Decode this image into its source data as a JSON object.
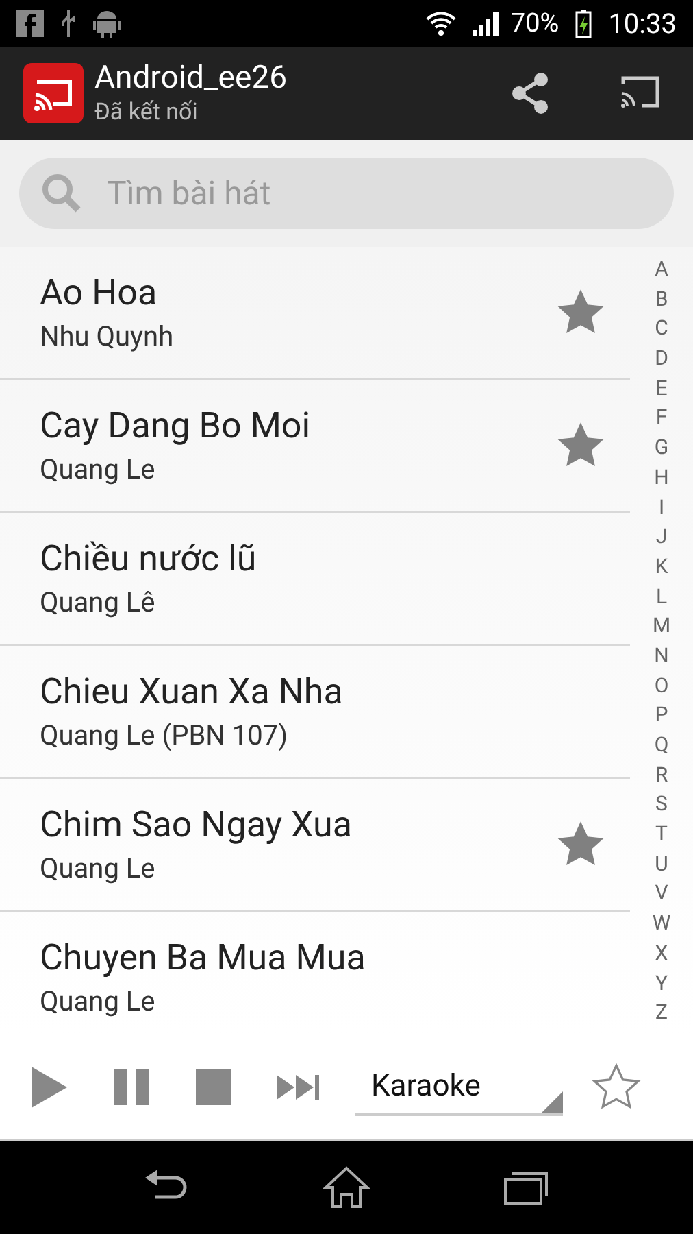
{
  "status_bar": {
    "battery": "70%",
    "time": "10:33"
  },
  "action_bar": {
    "title": "Android_ee26",
    "subtitle": "Đã kết nối"
  },
  "search": {
    "placeholder": "Tìm bài hát"
  },
  "songs": [
    {
      "title": "Ao Hoa",
      "artist": "Nhu Quynh",
      "favorite": true
    },
    {
      "title": "Cay Dang Bo Moi",
      "artist": "Quang Le",
      "favorite": true
    },
    {
      "title": "Chiều nước lũ",
      "artist": "Quang Lê",
      "favorite": false
    },
    {
      "title": "Chieu Xuan Xa Nha",
      "artist": "Quang Le (PBN 107)",
      "favorite": false
    },
    {
      "title": "Chim Sao Ngay Xua",
      "artist": "Quang Le",
      "favorite": true
    },
    {
      "title": "Chuyen Ba Mua Mua",
      "artist": "Quang Le",
      "favorite": false
    }
  ],
  "alphabet": [
    "A",
    "B",
    "C",
    "D",
    "E",
    "F",
    "G",
    "H",
    "I",
    "J",
    "K",
    "L",
    "M",
    "N",
    "O",
    "P",
    "Q",
    "R",
    "S",
    "T",
    "U",
    "V",
    "W",
    "X",
    "Y",
    "Z"
  ],
  "player": {
    "mode": "Karaoke",
    "favorite": false
  }
}
